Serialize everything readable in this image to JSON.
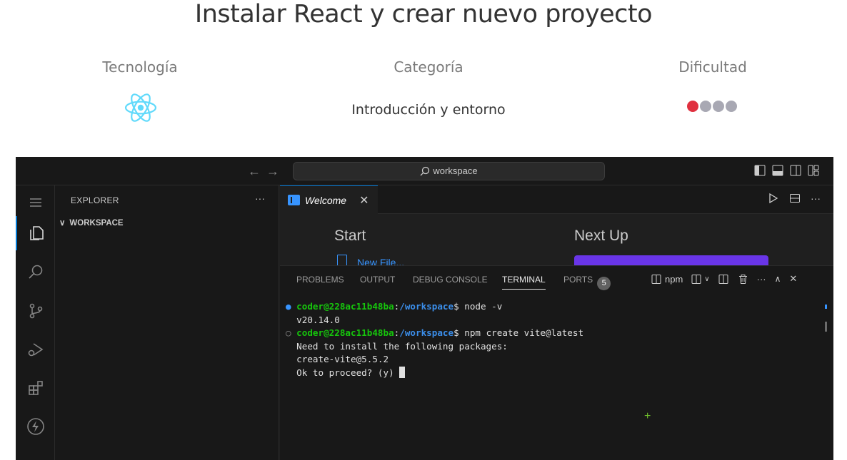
{
  "page": {
    "title": "Instalar React y crear nuevo proyecto",
    "tech_label": "Tecnología",
    "category_label": "Categoría",
    "category_value": "Introducción y entorno",
    "difficulty_label": "Dificultad",
    "difficulty_level": 1,
    "difficulty_max": 4,
    "colors": {
      "difficulty_active": "#e0303f",
      "difficulty_inactive": "#a8a8b3",
      "react_blue": "#61dafb"
    }
  },
  "vscode": {
    "search": {
      "text": "workspace"
    },
    "sidebar": {
      "title": "EXPLORER",
      "more": "···",
      "folder": "WORKSPACE"
    },
    "editor": {
      "tab_label": "Welcome",
      "tab_close": "✕",
      "start_heading": "Start",
      "new_file": "New File...",
      "next_heading": "Next Up"
    },
    "panel": {
      "tabs": [
        "PROBLEMS",
        "OUTPUT",
        "DEBUG CONSOLE",
        "TERMINAL",
        "PORTS"
      ],
      "ports_count": "5",
      "terminal_name": "npm",
      "active_tab": "TERMINAL"
    },
    "terminal": {
      "prompt_user": "coder@228ac11b48ba",
      "prompt_path": "/workspace",
      "cmd1": "node -v",
      "out1": "v20.14.0",
      "cmd2": "npm create vite@latest",
      "out2": "Need to install the following packages:",
      "out3": "create-vite@5.5.2",
      "out4": "Ok to proceed? (y) "
    }
  }
}
